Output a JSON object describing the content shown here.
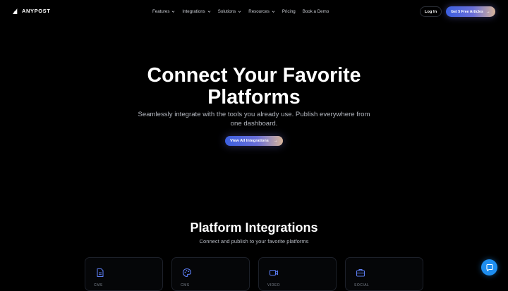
{
  "brand": {
    "name": "ANYPOST"
  },
  "nav": {
    "items": [
      {
        "label": "Features",
        "has_dropdown": true
      },
      {
        "label": "Integrations",
        "has_dropdown": true
      },
      {
        "label": "Solutions",
        "has_dropdown": true
      },
      {
        "label": "Resources",
        "has_dropdown": true
      },
      {
        "label": "Pricing",
        "has_dropdown": false
      },
      {
        "label": "Book a Demo",
        "has_dropdown": false
      }
    ],
    "login_label": "Log In",
    "cta_label": "Get 5 Free Articles",
    "cta_arrow": "→"
  },
  "hero": {
    "title": "Connect Your Favorite Platforms",
    "subtitle": "Seamlessly integrate with the tools you already use. Publish everywhere from one dashboard.",
    "button_label": "View All Integrations",
    "button_arrow": "→"
  },
  "section": {
    "title": "Platform Integrations",
    "subtitle": "Connect and publish to your favorite platforms"
  },
  "cards": [
    {
      "label": "CMS",
      "icon": "document-icon"
    },
    {
      "label": "CMS",
      "icon": "palette-icon"
    },
    {
      "label": "VIDEO",
      "icon": "video-icon"
    },
    {
      "label": "SOCIAL",
      "icon": "briefcase-icon"
    }
  ],
  "colors": {
    "background": "#000000",
    "accent_blue": "#3b5fe0",
    "accent_peach": "#d7b49a",
    "chat_blue": "#1e8ef0",
    "icon_blue": "#5b7cf0"
  },
  "chat": {
    "icon": "chat-bubble-icon"
  }
}
